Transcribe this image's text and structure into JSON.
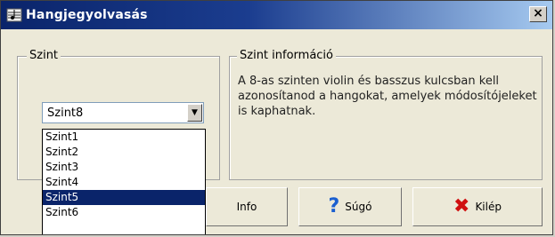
{
  "window": {
    "title": "Hangjegyolvasás",
    "close_label": "×"
  },
  "level_group": {
    "legend": "Szint",
    "selected_value": "Szint8",
    "options": [
      "Szint1",
      "Szint2",
      "Szint3",
      "Szint4",
      "Szint5",
      "Szint6"
    ],
    "highlighted_option": "Szint5"
  },
  "info_group": {
    "legend": "Szint információ",
    "text": "A 8-as szinten violin és basszus kulcsban kell azonosítanod a hangokat, amelyek módosítójeleket is kaphatnak."
  },
  "buttons": {
    "info_label": "Info",
    "help_label": "Súgó",
    "exit_label": "Kilép"
  },
  "colors": {
    "help_icon": "#1a5fd0",
    "exit_icon": "#d01010",
    "selection": "#0a246a"
  }
}
